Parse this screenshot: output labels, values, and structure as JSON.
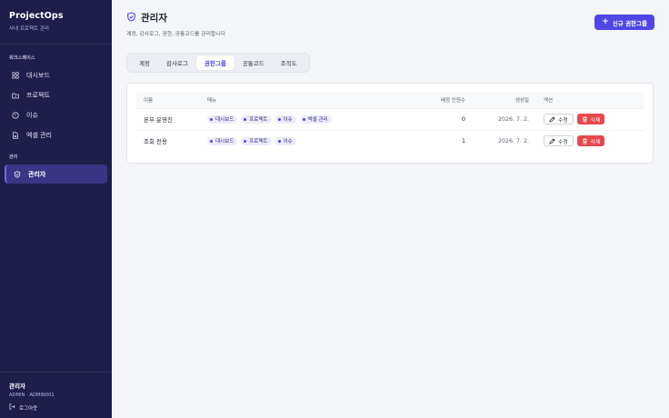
{
  "app": {
    "name": "ProjectOps",
    "subtitle": "사내 프로젝트 관리"
  },
  "sidebar": {
    "workspace_label": "워크스페이스",
    "workspace_items": [
      {
        "label": "대시보드",
        "icon": "grid-icon"
      },
      {
        "label": "프로젝트",
        "icon": "folder-icon"
      },
      {
        "label": "이슈",
        "icon": "alert-circle-icon"
      },
      {
        "label": "엑셀 관리",
        "icon": "file-icon"
      }
    ],
    "admin_label": "관리",
    "admin_items": [
      {
        "label": "관리자",
        "icon": "shield-icon",
        "active": true
      }
    ],
    "user": {
      "name": "관리자",
      "role": "ADMIN · ADMIN001",
      "logout": "로그아웃"
    }
  },
  "header": {
    "title": "관리자",
    "description": "계정, 감사로그, 권한, 공통코드를 관리합니다",
    "add_button": "신규 권한그룹"
  },
  "tabs": [
    {
      "label": "계정",
      "active": false
    },
    {
      "label": "감사로그",
      "active": false
    },
    {
      "label": "권한그룹",
      "active": true
    },
    {
      "label": "공통코드",
      "active": false
    },
    {
      "label": "조직도",
      "active": false
    }
  ],
  "table": {
    "columns": {
      "name": "이름",
      "menu": "메뉴",
      "count": "배정 인원수",
      "created": "생성일",
      "actions": "액션"
    },
    "rows": [
      {
        "name": "본부 운영진",
        "menus": [
          "대시보드",
          "프로젝트",
          "이슈",
          "엑셀 관리"
        ],
        "count": "0",
        "created": "2026. 7. 2."
      },
      {
        "name": "조회 전용",
        "menus": [
          "대시보드",
          "프로젝트",
          "이슈"
        ],
        "count": "1",
        "created": "2026. 7. 2."
      }
    ],
    "edit_label": "수정",
    "delete_label": "삭제"
  },
  "colors": {
    "sidebar": "#1f1d4a",
    "accent": "#4f46e5",
    "danger": "#e5484d"
  }
}
